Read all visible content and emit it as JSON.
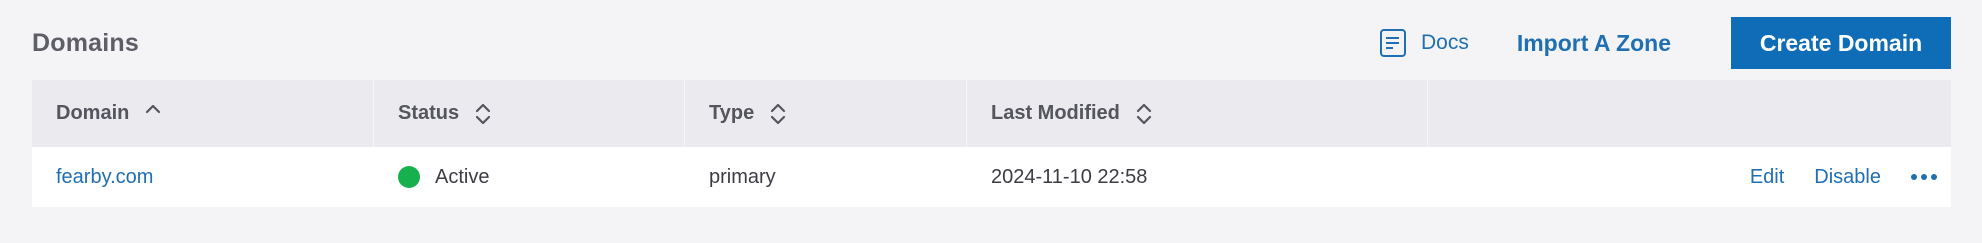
{
  "header": {
    "title": "Domains",
    "docs_label": "Docs",
    "import_label": "Import A Zone",
    "create_label": "Create Domain"
  },
  "table": {
    "columns": [
      {
        "label": "Domain",
        "sort": "ascending"
      },
      {
        "label": "Status",
        "sort": "none"
      },
      {
        "label": "Type",
        "sort": "none"
      },
      {
        "label": "Last Modified",
        "sort": "none"
      }
    ],
    "rows": [
      {
        "domain": "fearby.com",
        "status": "Active",
        "type": "primary",
        "last_modified": "2024-11-10 22:58",
        "actions": {
          "edit": "Edit",
          "disable": "Disable"
        }
      }
    ]
  },
  "icons": {
    "docs": "document-icon",
    "sort_asc": "chevron-up-icon",
    "sort_none": "sort-updown-icon",
    "more": "more-horizontal-icon"
  },
  "colors": {
    "accent": "#1f6fb2",
    "primary_button": "#0f6db7",
    "status_active": "#17b04e",
    "background": "#f4f4f7",
    "header_row": "#eaeaef"
  }
}
